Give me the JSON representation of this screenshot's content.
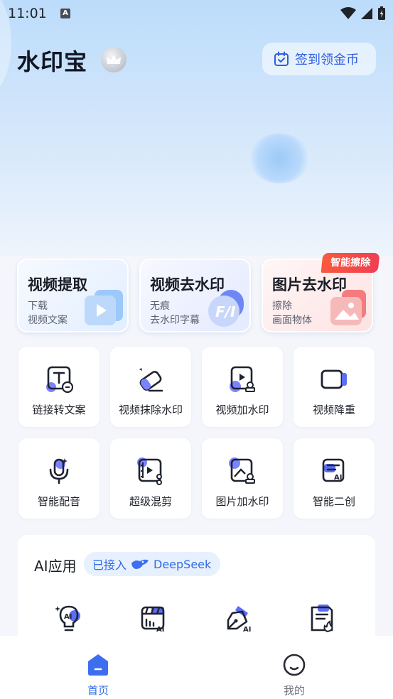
{
  "status_bar": {
    "time": "11:01",
    "notification_icon": "A"
  },
  "header": {
    "title": "水印宝",
    "vip_icon": "crown-icon",
    "signin_label": "签到领金币"
  },
  "feature_cards": [
    {
      "title": "视频提取",
      "sub1": "下载",
      "sub2": "视频文案",
      "icon": "play-icon",
      "bg": "#eaf3ff"
    },
    {
      "title": "视频去水印",
      "sub1": "无痕",
      "sub2": "去水印字幕",
      "icon": "watermark-icon",
      "bg": "#eaf0ff"
    },
    {
      "title": "图片去水印",
      "sub1": "擦除",
      "sub2": "画面物体",
      "icon": "image-icon",
      "bg": "#fdeeee",
      "badge": "智能擦除"
    }
  ],
  "tools": [
    {
      "label": "链接转文案",
      "icon": "link-text-icon"
    },
    {
      "label": "视频抹除水印",
      "icon": "eraser-icon"
    },
    {
      "label": "视频加水印",
      "icon": "video-stamp-icon"
    },
    {
      "label": "视频降重",
      "icon": "video-camera-icon"
    },
    {
      "label": "智能配音",
      "icon": "microphone-icon"
    },
    {
      "label": "超级混剪",
      "icon": "video-cut-icon"
    },
    {
      "label": "图片加水印",
      "icon": "image-stamp-icon"
    },
    {
      "label": "智能二创",
      "icon": "ai-create-icon"
    }
  ],
  "ai_section": {
    "title": "AI应用",
    "badge_prefix": "已接入",
    "badge_brand": "DeepSeek",
    "icons": [
      "ai-bulb-icon",
      "ai-clapboard-icon",
      "ai-pen-icon",
      "ai-document-icon"
    ]
  },
  "bottom_nav": [
    {
      "label": "首页",
      "icon": "home-icon",
      "active": true
    },
    {
      "label": "我的",
      "icon": "profile-icon",
      "active": false
    }
  ],
  "colors": {
    "accent": "#2f5de0",
    "active_nav": "#2f6be6",
    "inactive_nav": "#6d717a",
    "badge_red": "#f0465a"
  }
}
